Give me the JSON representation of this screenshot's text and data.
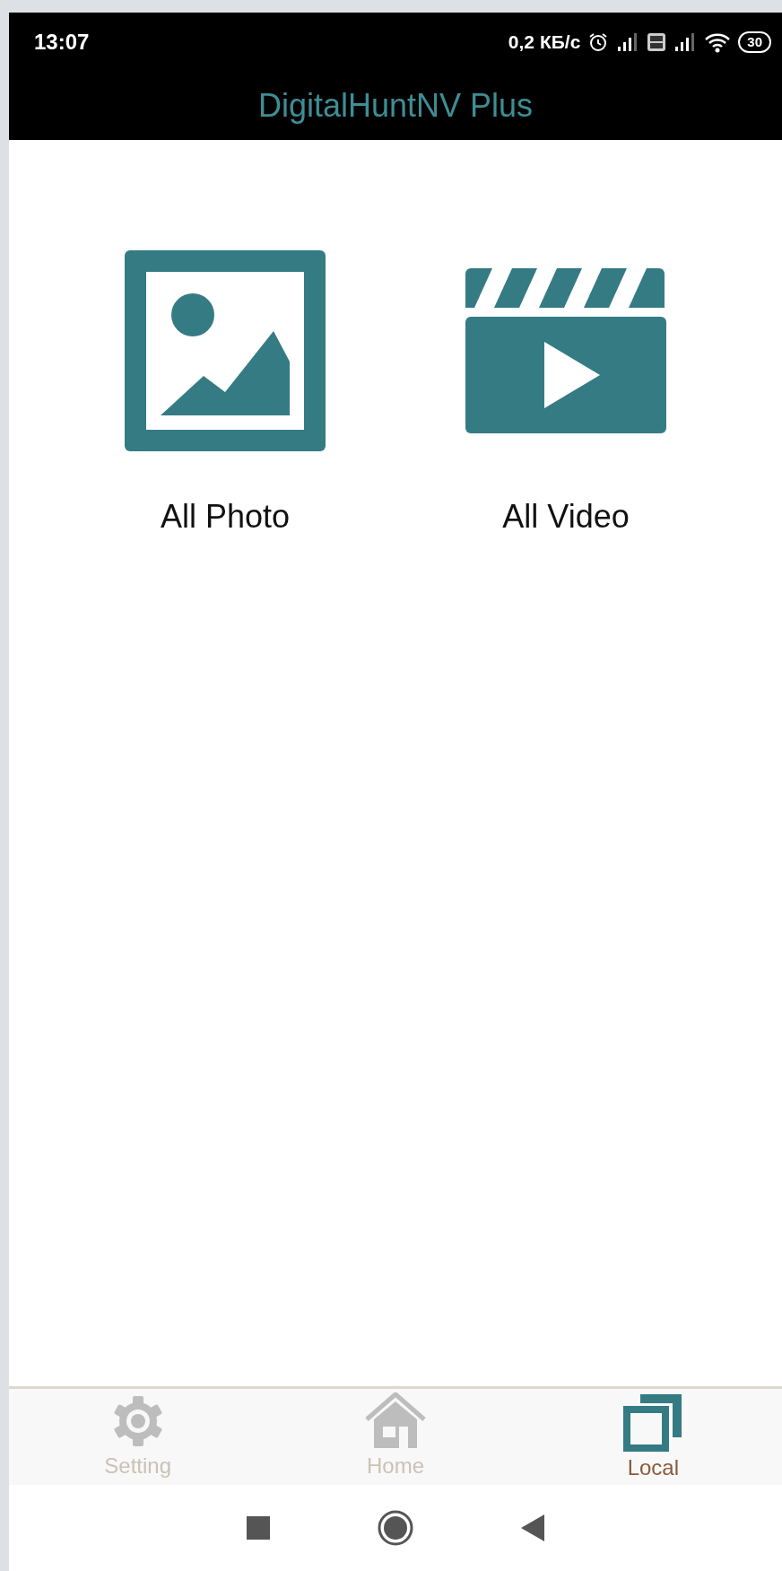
{
  "status_bar": {
    "time": "13:07",
    "net_speed": "0,2 КБ/с",
    "battery": "30"
  },
  "app_title": "DigitalHuntNV Plus",
  "media": [
    {
      "label": "All Photo",
      "kind": "photo"
    },
    {
      "label": "All Video",
      "kind": "video"
    }
  ],
  "tabs": [
    {
      "label": "Setting",
      "kind": "setting",
      "selected": false
    },
    {
      "label": "Home",
      "kind": "home",
      "selected": false
    },
    {
      "label": "Local",
      "kind": "local",
      "selected": true
    }
  ]
}
